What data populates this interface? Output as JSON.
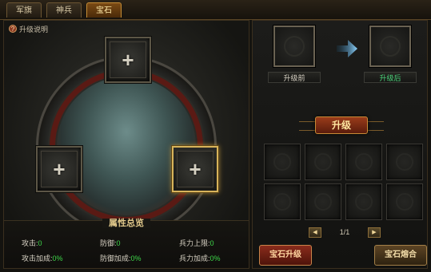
{
  "tabs": [
    {
      "label": "军旗",
      "active": false
    },
    {
      "label": "神兵",
      "active": false
    },
    {
      "label": "宝石",
      "active": true
    }
  ],
  "left_panel": {
    "help_icon": "question-icon",
    "help_label": "升级说明",
    "slots": [
      {
        "name": "top",
        "icon": "plus-icon",
        "selected": false
      },
      {
        "name": "left",
        "icon": "plus-icon",
        "selected": false
      },
      {
        "name": "right",
        "icon": "plus-icon",
        "selected": true
      }
    ],
    "stats_title": "属性总览",
    "stats": [
      {
        "label": "攻击:",
        "value": "0"
      },
      {
        "label": "防御:",
        "value": "0"
      },
      {
        "label": "兵力上限:",
        "value": "0"
      },
      {
        "label": "攻击加成:",
        "value": "0%"
      },
      {
        "label": "防御加成:",
        "value": "0%"
      },
      {
        "label": "兵力加成:",
        "value": "0%"
      }
    ]
  },
  "right_panel": {
    "before_label": "升级前",
    "after_label": "升级后",
    "arrow_icon": "arrow-right-icon",
    "upgrade_button": "升级",
    "inventory_cells": 8,
    "pager": {
      "text": "1/1",
      "prev_icon": "arrow-left-icon",
      "next_icon": "arrow-right-icon"
    },
    "gem_upgrade_button": "宝石升级",
    "gem_fusion_button": "宝石熔合"
  },
  "colors": {
    "accent_gold": "#d8b45a",
    "stat_value_green": "#3fd84a",
    "after_label_green": "#4ad27a",
    "tab_active": "#7a4a14"
  }
}
